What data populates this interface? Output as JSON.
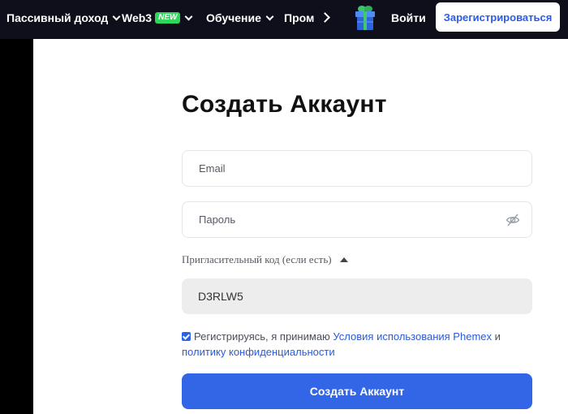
{
  "nav": {
    "passive_income": "Пассивный доход",
    "web3": "Web3",
    "new_badge": "NEW",
    "learning": "Обучение",
    "promo": "Пром",
    "login": "Войти",
    "register": "Зарегистрироваться"
  },
  "form": {
    "title": "Создать Аккаунт",
    "email_placeholder": "Email",
    "password_placeholder": "Пароль",
    "invite_label": "Пригласительный код (если есть)",
    "invite_value": "D3RLW5",
    "terms_prefix": "Регистрируясь, я принимаю ",
    "terms_link": "Условия использования Phemex",
    "terms_and": " и",
    "privacy_link": "политику конфиденциальности",
    "submit": "Создать Аккаунт"
  },
  "colors": {
    "nav_bg": "#0e0f1a",
    "primary": "#3366e6",
    "new_badge": "#2fd65a"
  },
  "icons": {
    "eye": "eye-off-icon",
    "gift": "gift-icon",
    "checkbox": "checkbox-checked-icon"
  }
}
